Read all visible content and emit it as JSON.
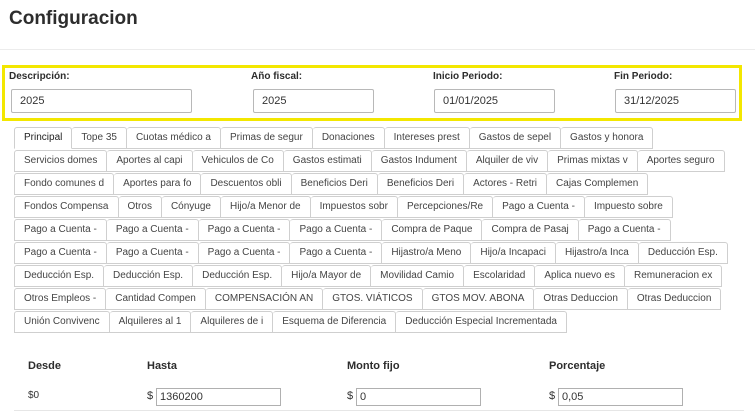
{
  "page": {
    "title": "Configuracion"
  },
  "form": {
    "descripcion": {
      "label": "Descripción:",
      "value": "2025"
    },
    "anio_fiscal": {
      "label": "Año fiscal:",
      "value": "2025"
    },
    "inicio": {
      "label": "Inicio Periodo:",
      "value": "01/01/2025"
    },
    "fin": {
      "label": "Fin Periodo:",
      "value": "31/12/2025"
    }
  },
  "tabs": [
    [
      "Principal",
      "Tope 35",
      "Cuotas médico a",
      "Primas de segur",
      "Donaciones",
      "Intereses prest",
      "Gastos de sepel",
      "Gastos y honora"
    ],
    [
      "Servicios domes",
      "Aportes al capi",
      "Vehiculos de Co",
      "Gastos estimati",
      "Gastos Indument",
      "Alquiler de viv",
      "Primas mixtas v",
      "Aportes seguro"
    ],
    [
      "Fondo comunes d",
      "Aportes para fo",
      "Descuentos obli",
      "Beneficios Deri",
      "Beneficios Deri",
      "Actores - Retri",
      "Cajas Complemen"
    ],
    [
      "Fondos Compensa",
      "Otros",
      "Cónyuge",
      "Hijo/a Menor de",
      "Impuestos sobr",
      "Percepciones/Re",
      "Pago a Cuenta -",
      "Impuesto sobre"
    ],
    [
      "Pago a Cuenta -",
      "Pago a Cuenta -",
      "Pago a Cuenta -",
      "Pago a Cuenta -",
      "Compra de Paque",
      "Compra de Pasaj",
      "Pago a Cuenta -"
    ],
    [
      "Pago a Cuenta -",
      "Pago a Cuenta -",
      "Pago a Cuenta -",
      "Pago a Cuenta -",
      "Hijastro/a Meno",
      "Hijo/a Incapaci",
      "Hijastro/a Inca",
      "Deducción Esp."
    ],
    [
      "Deducción Esp.",
      "Deducción Esp.",
      "Deducción Esp.",
      "Hijo/a Mayor de",
      "Movilidad Camio",
      "Escolaridad",
      "Aplica nuevo es",
      "Remuneracion ex"
    ],
    [
      "Otros Empleos -",
      "Cantidad Compen",
      "COMPENSACIÓN AN",
      "GTOS. VIÁTICOS",
      "GTOS MOV. ABONA",
      "Otras Deduccion",
      "Otras Deduccion"
    ],
    [
      "Unión Convivenc",
      "Alquileres al 1",
      "Alquileres de i",
      "Esquema de Diferencia",
      "Deducción Especial Incrementada"
    ]
  ],
  "active_tab": "Principal",
  "grid": {
    "headers": {
      "desde": "Desde",
      "hasta": "Hasta",
      "monto": "Monto fijo",
      "porcentaje": "Porcentaje"
    },
    "currency_symbol": "$",
    "row": {
      "desde": "$0",
      "hasta": "1360200",
      "monto": "0",
      "porcentaje": "0,05"
    }
  }
}
